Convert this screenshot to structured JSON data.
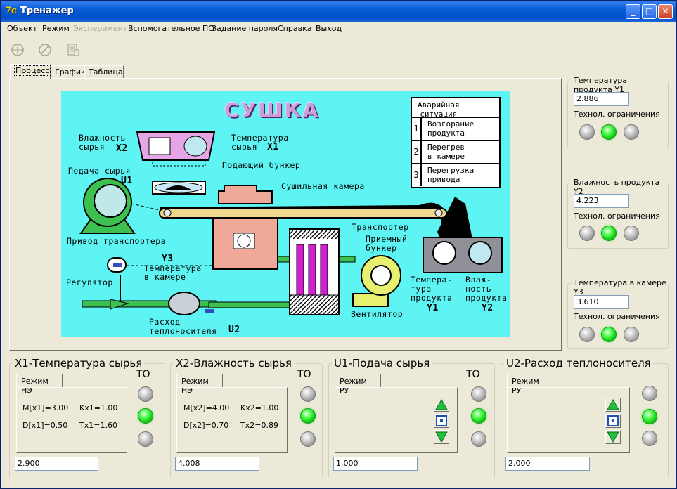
{
  "window": {
    "title": "Тренажер",
    "minimize": "_",
    "maximize": "□",
    "close": "✕"
  },
  "menu": [
    "Объект",
    "Режим",
    "Эксперимент",
    "Вспомогательное ПО",
    "Задание пароля",
    "Справка",
    "Выход"
  ],
  "toolbar": {
    "start_icon": "start-icon",
    "stop_icon": "stop-icon",
    "export_icon": "export-icon"
  },
  "tabs": [
    "Процесс",
    "График",
    "Таблица"
  ],
  "scheme": {
    "title": "СУШКА",
    "labels": {
      "moisture_raw": "Влажность\nсырья",
      "x2": "X2",
      "temp_raw": "Температура\nсырья",
      "x1": "X1",
      "feed_bunker": "Подающий бункер",
      "feed_raw": "Подача сырья",
      "u1": "U1",
      "dryer_chamber": "Сушильная камера",
      "transporter": "Транспортер",
      "transport_drive": "Привод транспортера",
      "receiving_bunker": "Приемный\nбункер",
      "y3": "Y3",
      "chamber_temp": "Температура\nв камере",
      "regulator": "Регулятор",
      "fan": "Вентилятор",
      "product_temp": "Темпера-\nтура\nпродукта",
      "y1": "Y1",
      "product_moisture": "Влаж-\nность\nпродукта",
      "y2": "Y2",
      "coolant_flow": "Расход\nтеплоносителя",
      "u2": "U2"
    },
    "alarm": {
      "header": "Аварийная\nситуация",
      "rows": [
        {
          "num": "1",
          "text": "Возгорание\nпродукта"
        },
        {
          "num": "2",
          "text": "Перегрев\nв камере"
        },
        {
          "num": "3",
          "text": "Перегрузка\nпривода"
        }
      ]
    }
  },
  "right_panels": [
    {
      "title": "Температура продукта Y1",
      "value": "2.886",
      "limits_label": "Технол. ограничения",
      "leds": [
        false,
        true,
        false
      ]
    },
    {
      "title": "Влажность продукта Y2",
      "value": "4.223",
      "limits_label": "Технол. ограничения",
      "leds": [
        false,
        true,
        false
      ]
    },
    {
      "title": "Температура в камере Y3",
      "value": "3.610",
      "limits_label": "Технол. ограничения",
      "leds": [
        false,
        true,
        false
      ]
    }
  ],
  "bottom_panels": [
    {
      "title": "X1-Температура сырья",
      "to": "ТО",
      "tab": "Режим НЭ",
      "params": [
        "M[x1]=3.00",
        "Kx1=1.00",
        "D[x1]=0.50",
        "Tx1=1.60"
      ],
      "value": "2.900",
      "leds": [
        false,
        true,
        false
      ]
    },
    {
      "title": "X2-Влажность сырья",
      "to": "ТО",
      "tab": "Режим НЭ",
      "params": [
        "M[x2]=4.00",
        "Kx2=1.00",
        "D[x2]=0.70",
        "Tx2=0.89"
      ],
      "value": "4.008",
      "leds": [
        false,
        true,
        false
      ]
    },
    {
      "title": "U1-Подача сырья",
      "to": "ТО",
      "tab": "Режим РУ",
      "value": "1.000",
      "leds": [
        false,
        true,
        false
      ]
    },
    {
      "title": "U2-Расход теплоносителя",
      "to": "",
      "tab": "Режим РУ",
      "value": "2.000",
      "leds": [
        false,
        true,
        false
      ]
    }
  ],
  "colors": {
    "scheme_bg": "#5ff4f4",
    "led_on": "#22dd22",
    "title_bar": "#0a5bd6"
  }
}
